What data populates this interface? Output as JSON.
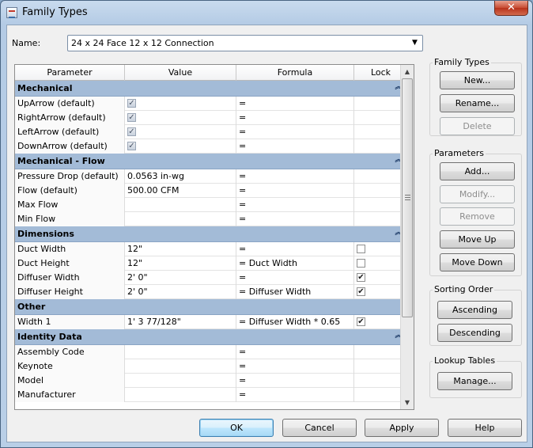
{
  "window": {
    "title": "Family Types",
    "close_glyph": "✕"
  },
  "name_field": {
    "label": "Name:",
    "value": "24 x 24 Face 12 x 12 Connection"
  },
  "table": {
    "columns": [
      "Parameter",
      "Value",
      "Formula",
      "Lock"
    ],
    "groups": [
      {
        "label": "Mechanical",
        "collapsible": true,
        "rows": [
          {
            "param": "UpArrow (default)",
            "value_checkbox": true,
            "formula": "=",
            "lock": null
          },
          {
            "param": "RightArrow (default)",
            "value_checkbox": true,
            "formula": "=",
            "lock": null
          },
          {
            "param": "LeftArrow (default)",
            "value_checkbox": true,
            "formula": "=",
            "lock": null
          },
          {
            "param": "DownArrow (default)",
            "value_checkbox": true,
            "formula": "=",
            "lock": null
          }
        ]
      },
      {
        "label": "Mechanical - Flow",
        "collapsible": true,
        "rows": [
          {
            "param": "Pressure Drop (default)",
            "value": "0.0563 in-wg",
            "formula": "=",
            "lock": null
          },
          {
            "param": "Flow (default)",
            "value": "500.00 CFM",
            "formula": "=",
            "lock": null
          },
          {
            "param": "Max Flow",
            "value": "",
            "formula": "=",
            "lock": null
          },
          {
            "param": "Min Flow",
            "value": "",
            "formula": "=",
            "lock": null
          }
        ]
      },
      {
        "label": "Dimensions",
        "collapsible": true,
        "rows": [
          {
            "param": "Duct Width",
            "value": "12\"",
            "formula": "=",
            "lock": false
          },
          {
            "param": "Duct Height",
            "value": "12\"",
            "formula": "= Duct Width",
            "lock": false
          },
          {
            "param": "Diffuser Width",
            "value": "2'  0\"",
            "formula": "=",
            "lock": true
          },
          {
            "param": "Diffuser Height",
            "value": "2'  0\"",
            "formula": "= Diffuser Width",
            "lock": true
          }
        ]
      },
      {
        "label": "Other",
        "collapsible": false,
        "rows": [
          {
            "param": "Width 1",
            "value": "1'  3 77/128\"",
            "formula": "= Diffuser Width * 0.65",
            "lock": true
          }
        ]
      },
      {
        "label": "Identity Data",
        "collapsible": true,
        "rows": [
          {
            "param": "Assembly Code",
            "value": "",
            "formula": "=",
            "lock": null
          },
          {
            "param": "Keynote",
            "value": "",
            "formula": "=",
            "lock": null
          },
          {
            "param": "Model",
            "value": "",
            "formula": "=",
            "lock": null
          },
          {
            "param": "Manufacturer",
            "value": "",
            "formula": "=",
            "lock": null
          }
        ]
      }
    ]
  },
  "panels": {
    "family_types": {
      "title": "Family Types",
      "new": "New...",
      "rename": "Rename...",
      "delete": "Delete"
    },
    "parameters": {
      "title": "Parameters",
      "add": "Add...",
      "modify": "Modify...",
      "remove": "Remove",
      "move_up": "Move Up",
      "move_down": "Move Down"
    },
    "sorting": {
      "title": "Sorting Order",
      "ascending": "Ascending",
      "descending": "Descending"
    },
    "lookup": {
      "title": "Lookup Tables",
      "manage": "Manage..."
    }
  },
  "footer": {
    "ok": "OK",
    "cancel": "Cancel",
    "apply": "Apply",
    "help": "Help"
  },
  "icons": {
    "collapse": "double-chevron-up-icon",
    "dropdown": "chevron-down-icon",
    "check": "checkmark-icon"
  }
}
